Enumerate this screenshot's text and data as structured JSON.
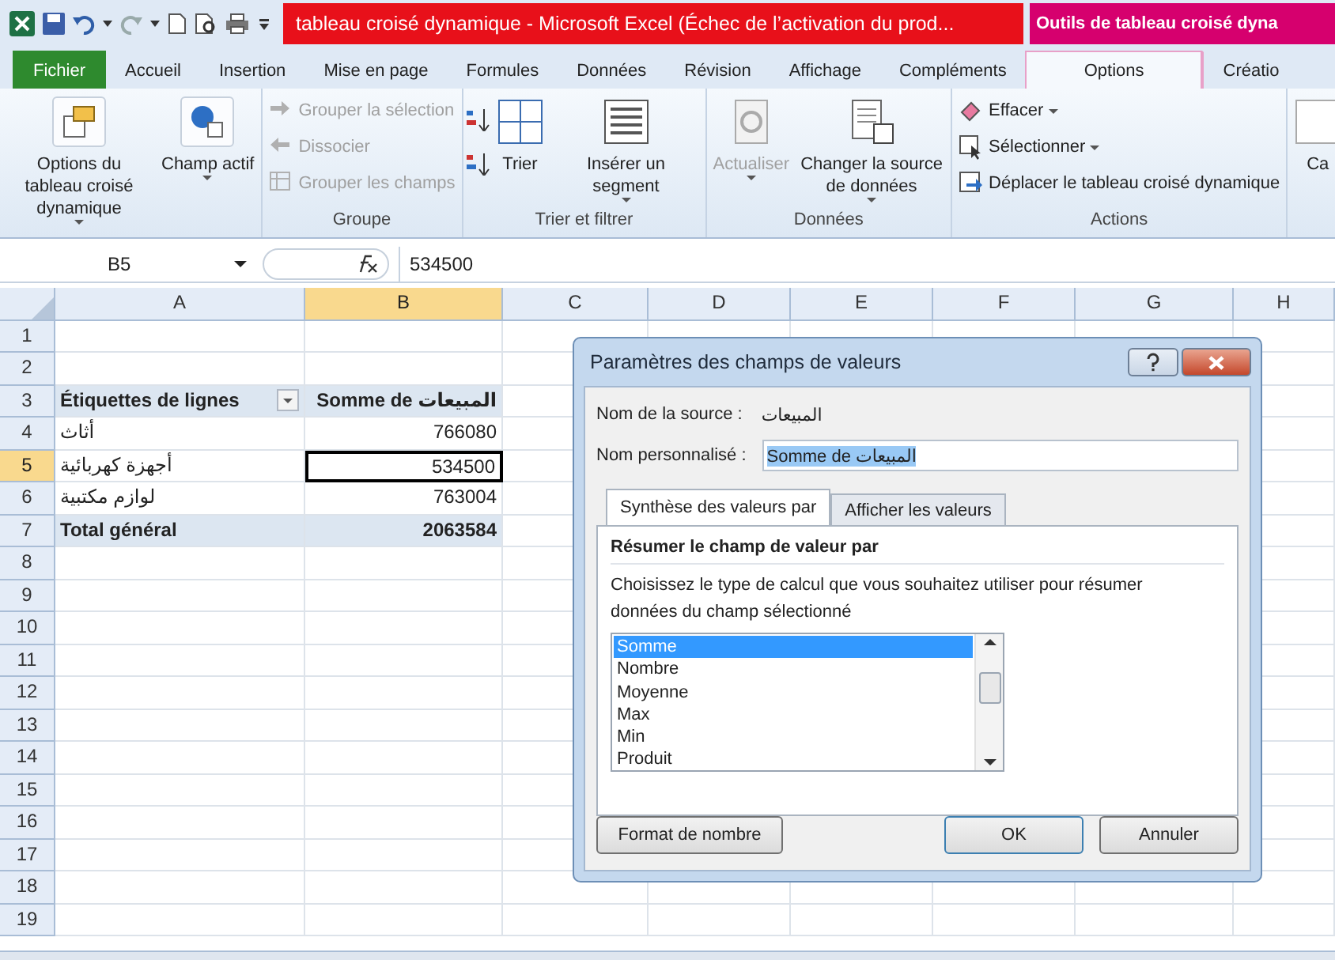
{
  "title_bar": {
    "title": "tableau croisé dynamique  -  Microsoft Excel (Échec de l’activation du prod...",
    "context_title": "Outils de tableau croisé dyna"
  },
  "ribbon_tabs": [
    {
      "label": "Fichier",
      "kind": "file",
      "selected": false
    },
    {
      "label": "Accueil",
      "kind": "tab",
      "selected": false
    },
    {
      "label": "Insertion",
      "kind": "tab",
      "selected": false
    },
    {
      "label": "Mise en page",
      "kind": "tab",
      "selected": false
    },
    {
      "label": "Formules",
      "kind": "tab",
      "selected": false
    },
    {
      "label": "Données",
      "kind": "tab",
      "selected": false
    },
    {
      "label": "Révision",
      "kind": "tab",
      "selected": false
    },
    {
      "label": "Affichage",
      "kind": "tab",
      "selected": false
    },
    {
      "label": "Compléments",
      "kind": "tab",
      "selected": false
    },
    {
      "label": "Options",
      "kind": "context",
      "selected": true
    },
    {
      "label": "Créatio",
      "kind": "context",
      "selected": false
    }
  ],
  "ribbon_groups": [
    {
      "items": [
        {
          "kind": "large",
          "label": "Options du tableau croisé dynamique",
          "dropdown": true,
          "disabled": false
        },
        {
          "kind": "large",
          "label": "Champ actif",
          "dropdown": true,
          "disabled": false
        }
      ]
    },
    {
      "label": "Groupe",
      "items": [
        {
          "kind": "small",
          "label": "Grouper la sélection",
          "dropdown": false,
          "disabled": true
        },
        {
          "kind": "small",
          "label": "Dissocier",
          "dropdown": false,
          "disabled": true
        },
        {
          "kind": "small",
          "label": "Grouper les champs",
          "dropdown": false,
          "disabled": true
        }
      ]
    },
    {
      "label": "Trier et filtrer",
      "items": [
        {
          "kind": "stack",
          "dropdown": false,
          "disabled": false
        },
        {
          "kind": "large",
          "label": "Trier",
          "dropdown": false,
          "disabled": false
        },
        {
          "kind": "large",
          "label": "Insérer un segment",
          "dropdown": true,
          "disabled": false
        }
      ]
    },
    {
      "label": "Données",
      "items": [
        {
          "kind": "large",
          "label": "Actualiser",
          "dropdown": true,
          "disabled": true
        },
        {
          "kind": "large",
          "label": "Changer la source de données",
          "dropdown": true,
          "disabled": false
        }
      ]
    },
    {
      "label": "Actions",
      "items": [
        {
          "kind": "small",
          "label": "Effacer",
          "dropdown": true,
          "disabled": false
        },
        {
          "kind": "small",
          "label": "Sélectionner",
          "dropdown": true,
          "disabled": false
        },
        {
          "kind": "small",
          "label": "Déplacer le tableau croisé dynamique",
          "dropdown": false,
          "disabled": false
        }
      ]
    },
    {
      "items": [
        {
          "kind": "large",
          "label": "Ca",
          "dropdown": false,
          "disabled": false
        }
      ]
    }
  ],
  "formula_bar": {
    "name_box": "B5",
    "formula": "534500"
  },
  "sheet": {
    "columns": [
      {
        "label": "A",
        "selected": false
      },
      {
        "label": "B",
        "selected": true
      },
      {
        "label": "C",
        "selected": false
      },
      {
        "label": "D",
        "selected": false
      },
      {
        "label": "E",
        "selected": false
      },
      {
        "label": "F",
        "selected": false
      },
      {
        "label": "G",
        "selected": false
      },
      {
        "label": "H",
        "selected": false
      }
    ],
    "rows": [
      {
        "number": "1",
        "selected": false,
        "kind": "empty"
      },
      {
        "number": "2",
        "selected": false,
        "kind": "empty"
      },
      {
        "number": "3",
        "selected": false,
        "kind": "header",
        "label": "Étiquettes de lignes",
        "value": "Somme de المبيعات"
      },
      {
        "number": "4",
        "selected": false,
        "kind": "item",
        "label": "أثاث",
        "value": "766080"
      },
      {
        "number": "5",
        "selected": true,
        "kind": "item",
        "label": "أجهزة كهربائية",
        "value": "534500"
      },
      {
        "number": "6",
        "selected": false,
        "kind": "item",
        "label": "لوازم مكتبية",
        "value": "763004"
      },
      {
        "number": "7",
        "selected": false,
        "kind": "total",
        "label": "Total général",
        "value": "2063584"
      },
      {
        "number": "8",
        "selected": false,
        "kind": "empty"
      },
      {
        "number": "9",
        "selected": false,
        "kind": "empty"
      },
      {
        "number": "10",
        "selected": false,
        "kind": "empty"
      },
      {
        "number": "11",
        "selected": false,
        "kind": "empty"
      },
      {
        "number": "12",
        "selected": false,
        "kind": "empty"
      },
      {
        "number": "13",
        "selected": false,
        "kind": "empty"
      },
      {
        "number": "14",
        "selected": false,
        "kind": "empty"
      },
      {
        "number": "15",
        "selected": false,
        "kind": "empty"
      },
      {
        "number": "16",
        "selected": false,
        "kind": "empty"
      },
      {
        "number": "17",
        "selected": false,
        "kind": "empty"
      },
      {
        "number": "18",
        "selected": false,
        "kind": "empty"
      },
      {
        "number": "19",
        "selected": false,
        "kind": "empty"
      }
    ]
  },
  "dialog": {
    "title": "Paramètres des champs de valeurs",
    "source_label": "Nom de la source :",
    "source_value": "المبيعات",
    "custom_name_label": "Nom personnalisé :",
    "custom_name_value": "Somme de المبيعات",
    "tabs": [
      {
        "label": "Synthèse des valeurs par",
        "selected": true
      },
      {
        "label": "Afficher les valeurs",
        "selected": false
      }
    ],
    "section_title": "Résumer le champ de valeur par",
    "description": "Choisissez le type de calcul que vous souhaitez utiliser pour résumer données du champ sélectionné",
    "functions": [
      {
        "label": "Somme",
        "selected": true
      },
      {
        "label": "Nombre",
        "selected": false
      },
      {
        "label": "Moyenne",
        "selected": false
      },
      {
        "label": "Max",
        "selected": false
      },
      {
        "label": "Min",
        "selected": false
      },
      {
        "label": "Produit",
        "selected": false
      }
    ],
    "buttons": [
      {
        "label": "Format de nombre",
        "kind": "left"
      },
      {
        "label": "OK",
        "kind": "default"
      },
      {
        "label": "Annuler",
        "kind": "normal"
      }
    ]
  }
}
